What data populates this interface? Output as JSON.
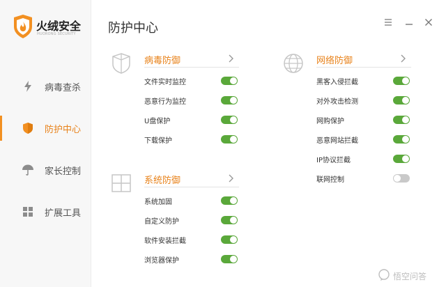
{
  "app": {
    "name": "火绒安全",
    "subtitle": "HUORONG SECURITY"
  },
  "sidebar": {
    "items": [
      {
        "label": "病毒查杀",
        "icon": "lightning-icon"
      },
      {
        "label": "防护中心",
        "icon": "shield-icon",
        "active": true
      },
      {
        "label": "家长控制",
        "icon": "umbrella-icon"
      },
      {
        "label": "扩展工具",
        "icon": "grid-icon"
      }
    ]
  },
  "page": {
    "title": "防护中心"
  },
  "sections": {
    "virus": {
      "title": "病毒防御",
      "items": [
        {
          "label": "文件实时监控",
          "on": true
        },
        {
          "label": "恶意行为监控",
          "on": true
        },
        {
          "label": "U盘保护",
          "on": true
        },
        {
          "label": "下载保护",
          "on": true
        }
      ]
    },
    "system": {
      "title": "系统防御",
      "items": [
        {
          "label": "系统加固",
          "on": true
        },
        {
          "label": "自定义防护",
          "on": true
        },
        {
          "label": "软件安装拦截",
          "on": true
        },
        {
          "label": "浏览器保护",
          "on": true
        }
      ]
    },
    "network": {
      "title": "网络防御",
      "items": [
        {
          "label": "黑客入侵拦截",
          "on": true
        },
        {
          "label": "对外攻击检测",
          "on": true
        },
        {
          "label": "网购保护",
          "on": true
        },
        {
          "label": "恶意网站拦截",
          "on": true
        },
        {
          "label": "IP协议拦截",
          "on": true
        },
        {
          "label": "联网控制",
          "on": false
        }
      ]
    }
  },
  "colors": {
    "accent": "#f29022",
    "toggle_on": "#5aa83a",
    "toggle_off": "#c9c9c9"
  },
  "watermark": {
    "text": "悟空问答"
  }
}
